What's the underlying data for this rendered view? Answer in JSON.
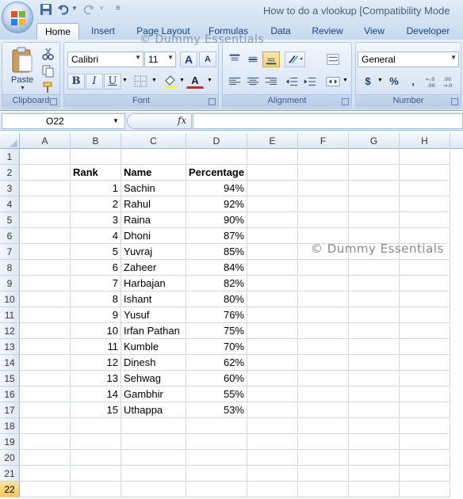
{
  "titlebar": {
    "title": "How to do a vlookup  [Compatibility Mode"
  },
  "tabs": [
    {
      "label": "Home",
      "active": true
    },
    {
      "label": "Insert",
      "active": false
    },
    {
      "label": "Page Layout",
      "active": false
    },
    {
      "label": "Formulas",
      "active": false
    },
    {
      "label": "Data",
      "active": false
    },
    {
      "label": "Review",
      "active": false
    },
    {
      "label": "View",
      "active": false
    },
    {
      "label": "Developer",
      "active": false
    }
  ],
  "watermarks": {
    "top": "© Dummy Essentials",
    "middle": "© Dummy Essentials"
  },
  "ribbon": {
    "clipboard": {
      "label": "Clipboard",
      "paste_label": "Paste"
    },
    "font": {
      "label": "Font",
      "font_name": "Calibri",
      "font_size": "11",
      "grow_label": "A",
      "shrink_label": "A",
      "bold": "B",
      "italic": "I",
      "underline": "U",
      "font_color_label": "A"
    },
    "alignment": {
      "label": "Alignment"
    },
    "number": {
      "label": "Number",
      "format": "General",
      "currency": "$",
      "percent": "%",
      "comma": ","
    }
  },
  "formula_bar": {
    "name_box": "O22",
    "fx": "fx",
    "formula": ""
  },
  "columns": [
    "A",
    "B",
    "C",
    "D",
    "E",
    "F",
    "G",
    "H"
  ],
  "row_numbers": [
    "1",
    "2",
    "3",
    "4",
    "5",
    "6",
    "7",
    "8",
    "9",
    "10",
    "11",
    "12",
    "13",
    "14",
    "15",
    "16",
    "17",
    "18",
    "19",
    "20",
    "21",
    "22"
  ],
  "active_row": "22",
  "table": {
    "headers": [
      "Rank",
      "Name",
      "Percentage"
    ],
    "rows": [
      [
        "1",
        "Sachin",
        "94%"
      ],
      [
        "2",
        "Rahul",
        "92%"
      ],
      [
        "3",
        "Raina",
        "90%"
      ],
      [
        "4",
        "Dhoni",
        "87%"
      ],
      [
        "5",
        "Yuvraj",
        "85%"
      ],
      [
        "6",
        "Zaheer",
        "84%"
      ],
      [
        "7",
        "Harbajan",
        "82%"
      ],
      [
        "8",
        "Ishant",
        "80%"
      ],
      [
        "9",
        "Yusuf",
        "76%"
      ],
      [
        "10",
        "Irfan Pathan",
        "75%"
      ],
      [
        "11",
        "Kumble",
        "70%"
      ],
      [
        "12",
        "Dinesh",
        "62%"
      ],
      [
        "13",
        "Sehwag",
        "60%"
      ],
      [
        "14",
        "Gambhir",
        "55%"
      ],
      [
        "15",
        "Uthappa",
        "53%"
      ]
    ]
  },
  "colors": {
    "ribbon_accent": "#15428b",
    "active_highlight": "#f6c65b",
    "office_logo_red": "#d9452b"
  }
}
